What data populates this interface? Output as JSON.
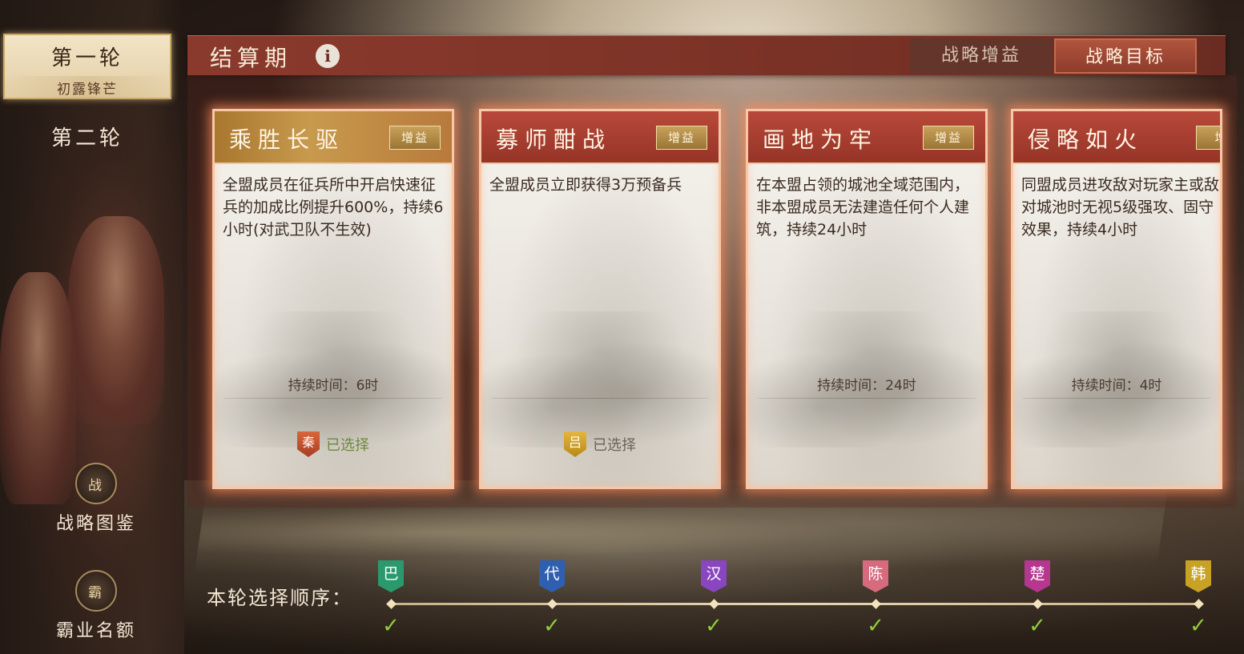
{
  "sidebar": {
    "round1": {
      "title": "第一轮",
      "subtitle": "初露锋芒"
    },
    "round2": {
      "title": "第二轮"
    },
    "codex": {
      "label": "战略图鉴",
      "icon": "战"
    },
    "hegemony": {
      "label": "霸业名额",
      "icon": "霸"
    }
  },
  "header": {
    "title": "结算期",
    "info_icon": "i",
    "tabs": [
      {
        "label": "战略增益",
        "active": false
      },
      {
        "label": "战略目标",
        "active": true
      }
    ]
  },
  "cards": [
    {
      "title": "乘胜长驱",
      "tag": "增益",
      "desc": "全盟成员在征兵所中开启快速征兵的加成比例提升600%，持续6小时(对武卫队不生效)",
      "duration": "持续时间：6时",
      "selected": "已选择",
      "faction": "秦"
    },
    {
      "title": "募师酣战",
      "tag": "增益",
      "desc": "全盟成员立即获得3万预备兵",
      "duration": "",
      "selected": "已选择",
      "faction": "吕"
    },
    {
      "title": "画地为牢",
      "tag": "增益",
      "desc": "在本盟占领的城池全域范围内，非本盟成员无法建造任何个人建筑，持续24小时",
      "duration": "持续时间：24时",
      "selected": "",
      "faction": ""
    },
    {
      "title": "侵略如火",
      "tag": "增",
      "desc": "同盟成员进攻敌对玩家主或敌对城池时无视5级强攻、固守效果，持续4小时",
      "duration": "持续时间：4时",
      "selected": "",
      "faction": ""
    }
  ],
  "timeline": {
    "label": "本轮选择顺序：",
    "check": "✓",
    "nodes": [
      {
        "name": "巴",
        "color": "#2a9a6e"
      },
      {
        "name": "代",
        "color": "#2f5fb0"
      },
      {
        "name": "汉",
        "color": "#8a45c0"
      },
      {
        "name": "陈",
        "color": "#d86a7e"
      },
      {
        "name": "楚",
        "color": "#b6378f"
      },
      {
        "name": "韩",
        "color": "#c8a225"
      }
    ]
  }
}
